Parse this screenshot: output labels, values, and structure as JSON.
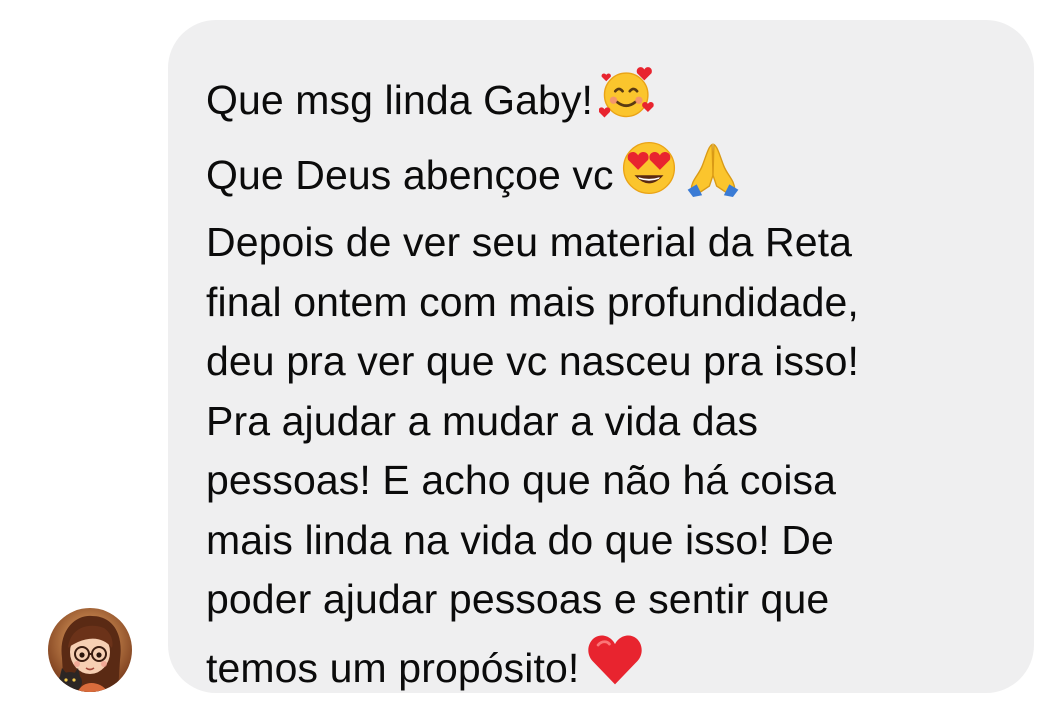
{
  "message": {
    "lines": [
      {
        "text": "Que msg linda Gaby!",
        "emoji": [
          "smiling-face-with-hearts-icon"
        ]
      },
      {
        "text": "Que Deus abençoe vc",
        "emoji": [
          "heart-eyes-icon",
          "folded-hands-icon"
        ]
      },
      {
        "text": "Depois de ver seu material da Reta"
      },
      {
        "text": "final ontem com mais profundidade,"
      },
      {
        "text": "deu pra ver que vc nasceu pra isso!"
      },
      {
        "text": "Pra ajudar a mudar a vida das"
      },
      {
        "text": "pessoas! E acho que não há coisa"
      },
      {
        "text": "mais linda na vida do que isso! De"
      },
      {
        "text": "poder ajudar pessoas e sentir que"
      },
      {
        "text": "temos um propósito!",
        "emoji": [
          "red-heart-icon"
        ]
      }
    ]
  },
  "colors": {
    "bubble": "#efeff0",
    "text": "#0b0b0b",
    "heart": "#e8242f"
  }
}
